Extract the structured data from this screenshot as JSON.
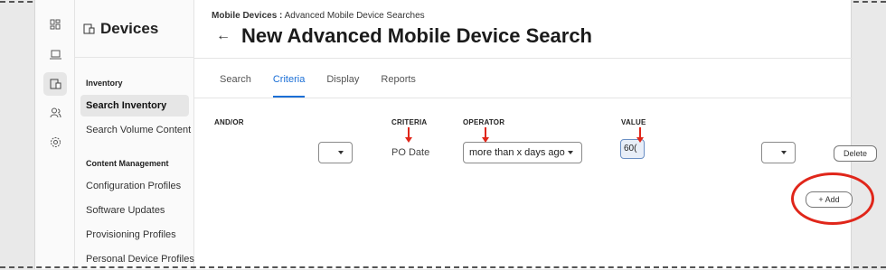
{
  "sidebar": {
    "title": "Devices",
    "sections": [
      {
        "label": "Inventory"
      },
      {
        "label": "Content Management"
      }
    ],
    "items": [
      {
        "label": "Search Inventory"
      },
      {
        "label": "Search Volume Content"
      },
      {
        "label": "Configuration Profiles"
      },
      {
        "label": "Software Updates"
      },
      {
        "label": "Provisioning Profiles"
      },
      {
        "label": "Personal Device Profiles"
      }
    ]
  },
  "rail": {
    "icons": [
      "dashboard-icon",
      "computer-icon",
      "mobile-devices-icon",
      "users-icon",
      "settings-icon"
    ]
  },
  "header": {
    "breadcrumb_parent": "Mobile Devices :",
    "breadcrumb_current": "Advanced Mobile Device Searches",
    "back_symbol": "←",
    "title": "New Advanced Mobile Device Search"
  },
  "tabs": [
    {
      "label": "Search"
    },
    {
      "label": "Criteria"
    },
    {
      "label": "Display"
    },
    {
      "label": "Reports"
    }
  ],
  "criteria": {
    "headers": {
      "and_or": "AND/OR",
      "criteria": "CRITERIA",
      "operator": "OPERATOR",
      "value": "VALUE"
    },
    "row": {
      "criteria": "PO Date",
      "operator": "more than x days ago",
      "value": "60("
    },
    "delete_label": "Delete",
    "add_label": "+ Add"
  },
  "colors": {
    "accent": "#1b6fd6",
    "annotation": "#e0261a"
  }
}
